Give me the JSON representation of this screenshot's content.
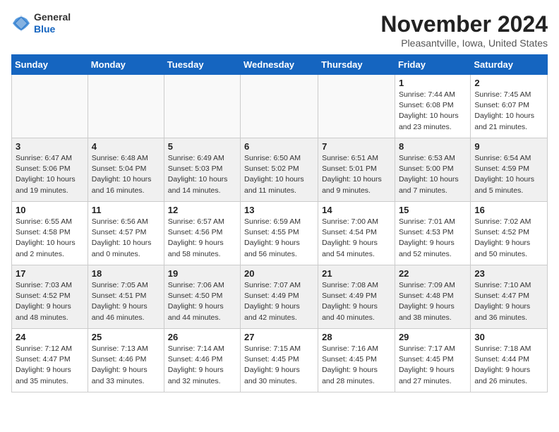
{
  "header": {
    "logo_general": "General",
    "logo_blue": "Blue",
    "month_title": "November 2024",
    "location": "Pleasantville, Iowa, United States"
  },
  "weekdays": [
    "Sunday",
    "Monday",
    "Tuesday",
    "Wednesday",
    "Thursday",
    "Friday",
    "Saturday"
  ],
  "weeks": [
    [
      {
        "day": "",
        "info": ""
      },
      {
        "day": "",
        "info": ""
      },
      {
        "day": "",
        "info": ""
      },
      {
        "day": "",
        "info": ""
      },
      {
        "day": "",
        "info": ""
      },
      {
        "day": "1",
        "info": "Sunrise: 7:44 AM\nSunset: 6:08 PM\nDaylight: 10 hours\nand 23 minutes."
      },
      {
        "day": "2",
        "info": "Sunrise: 7:45 AM\nSunset: 6:07 PM\nDaylight: 10 hours\nand 21 minutes."
      }
    ],
    [
      {
        "day": "3",
        "info": "Sunrise: 6:47 AM\nSunset: 5:06 PM\nDaylight: 10 hours\nand 19 minutes."
      },
      {
        "day": "4",
        "info": "Sunrise: 6:48 AM\nSunset: 5:04 PM\nDaylight: 10 hours\nand 16 minutes."
      },
      {
        "day": "5",
        "info": "Sunrise: 6:49 AM\nSunset: 5:03 PM\nDaylight: 10 hours\nand 14 minutes."
      },
      {
        "day": "6",
        "info": "Sunrise: 6:50 AM\nSunset: 5:02 PM\nDaylight: 10 hours\nand 11 minutes."
      },
      {
        "day": "7",
        "info": "Sunrise: 6:51 AM\nSunset: 5:01 PM\nDaylight: 10 hours\nand 9 minutes."
      },
      {
        "day": "8",
        "info": "Sunrise: 6:53 AM\nSunset: 5:00 PM\nDaylight: 10 hours\nand 7 minutes."
      },
      {
        "day": "9",
        "info": "Sunrise: 6:54 AM\nSunset: 4:59 PM\nDaylight: 10 hours\nand 5 minutes."
      }
    ],
    [
      {
        "day": "10",
        "info": "Sunrise: 6:55 AM\nSunset: 4:58 PM\nDaylight: 10 hours\nand 2 minutes."
      },
      {
        "day": "11",
        "info": "Sunrise: 6:56 AM\nSunset: 4:57 PM\nDaylight: 10 hours\nand 0 minutes."
      },
      {
        "day": "12",
        "info": "Sunrise: 6:57 AM\nSunset: 4:56 PM\nDaylight: 9 hours\nand 58 minutes."
      },
      {
        "day": "13",
        "info": "Sunrise: 6:59 AM\nSunset: 4:55 PM\nDaylight: 9 hours\nand 56 minutes."
      },
      {
        "day": "14",
        "info": "Sunrise: 7:00 AM\nSunset: 4:54 PM\nDaylight: 9 hours\nand 54 minutes."
      },
      {
        "day": "15",
        "info": "Sunrise: 7:01 AM\nSunset: 4:53 PM\nDaylight: 9 hours\nand 52 minutes."
      },
      {
        "day": "16",
        "info": "Sunrise: 7:02 AM\nSunset: 4:52 PM\nDaylight: 9 hours\nand 50 minutes."
      }
    ],
    [
      {
        "day": "17",
        "info": "Sunrise: 7:03 AM\nSunset: 4:52 PM\nDaylight: 9 hours\nand 48 minutes."
      },
      {
        "day": "18",
        "info": "Sunrise: 7:05 AM\nSunset: 4:51 PM\nDaylight: 9 hours\nand 46 minutes."
      },
      {
        "day": "19",
        "info": "Sunrise: 7:06 AM\nSunset: 4:50 PM\nDaylight: 9 hours\nand 44 minutes."
      },
      {
        "day": "20",
        "info": "Sunrise: 7:07 AM\nSunset: 4:49 PM\nDaylight: 9 hours\nand 42 minutes."
      },
      {
        "day": "21",
        "info": "Sunrise: 7:08 AM\nSunset: 4:49 PM\nDaylight: 9 hours\nand 40 minutes."
      },
      {
        "day": "22",
        "info": "Sunrise: 7:09 AM\nSunset: 4:48 PM\nDaylight: 9 hours\nand 38 minutes."
      },
      {
        "day": "23",
        "info": "Sunrise: 7:10 AM\nSunset: 4:47 PM\nDaylight: 9 hours\nand 36 minutes."
      }
    ],
    [
      {
        "day": "24",
        "info": "Sunrise: 7:12 AM\nSunset: 4:47 PM\nDaylight: 9 hours\nand 35 minutes."
      },
      {
        "day": "25",
        "info": "Sunrise: 7:13 AM\nSunset: 4:46 PM\nDaylight: 9 hours\nand 33 minutes."
      },
      {
        "day": "26",
        "info": "Sunrise: 7:14 AM\nSunset: 4:46 PM\nDaylight: 9 hours\nand 32 minutes."
      },
      {
        "day": "27",
        "info": "Sunrise: 7:15 AM\nSunset: 4:45 PM\nDaylight: 9 hours\nand 30 minutes."
      },
      {
        "day": "28",
        "info": "Sunrise: 7:16 AM\nSunset: 4:45 PM\nDaylight: 9 hours\nand 28 minutes."
      },
      {
        "day": "29",
        "info": "Sunrise: 7:17 AM\nSunset: 4:45 PM\nDaylight: 9 hours\nand 27 minutes."
      },
      {
        "day": "30",
        "info": "Sunrise: 7:18 AM\nSunset: 4:44 PM\nDaylight: 9 hours\nand 26 minutes."
      }
    ]
  ]
}
